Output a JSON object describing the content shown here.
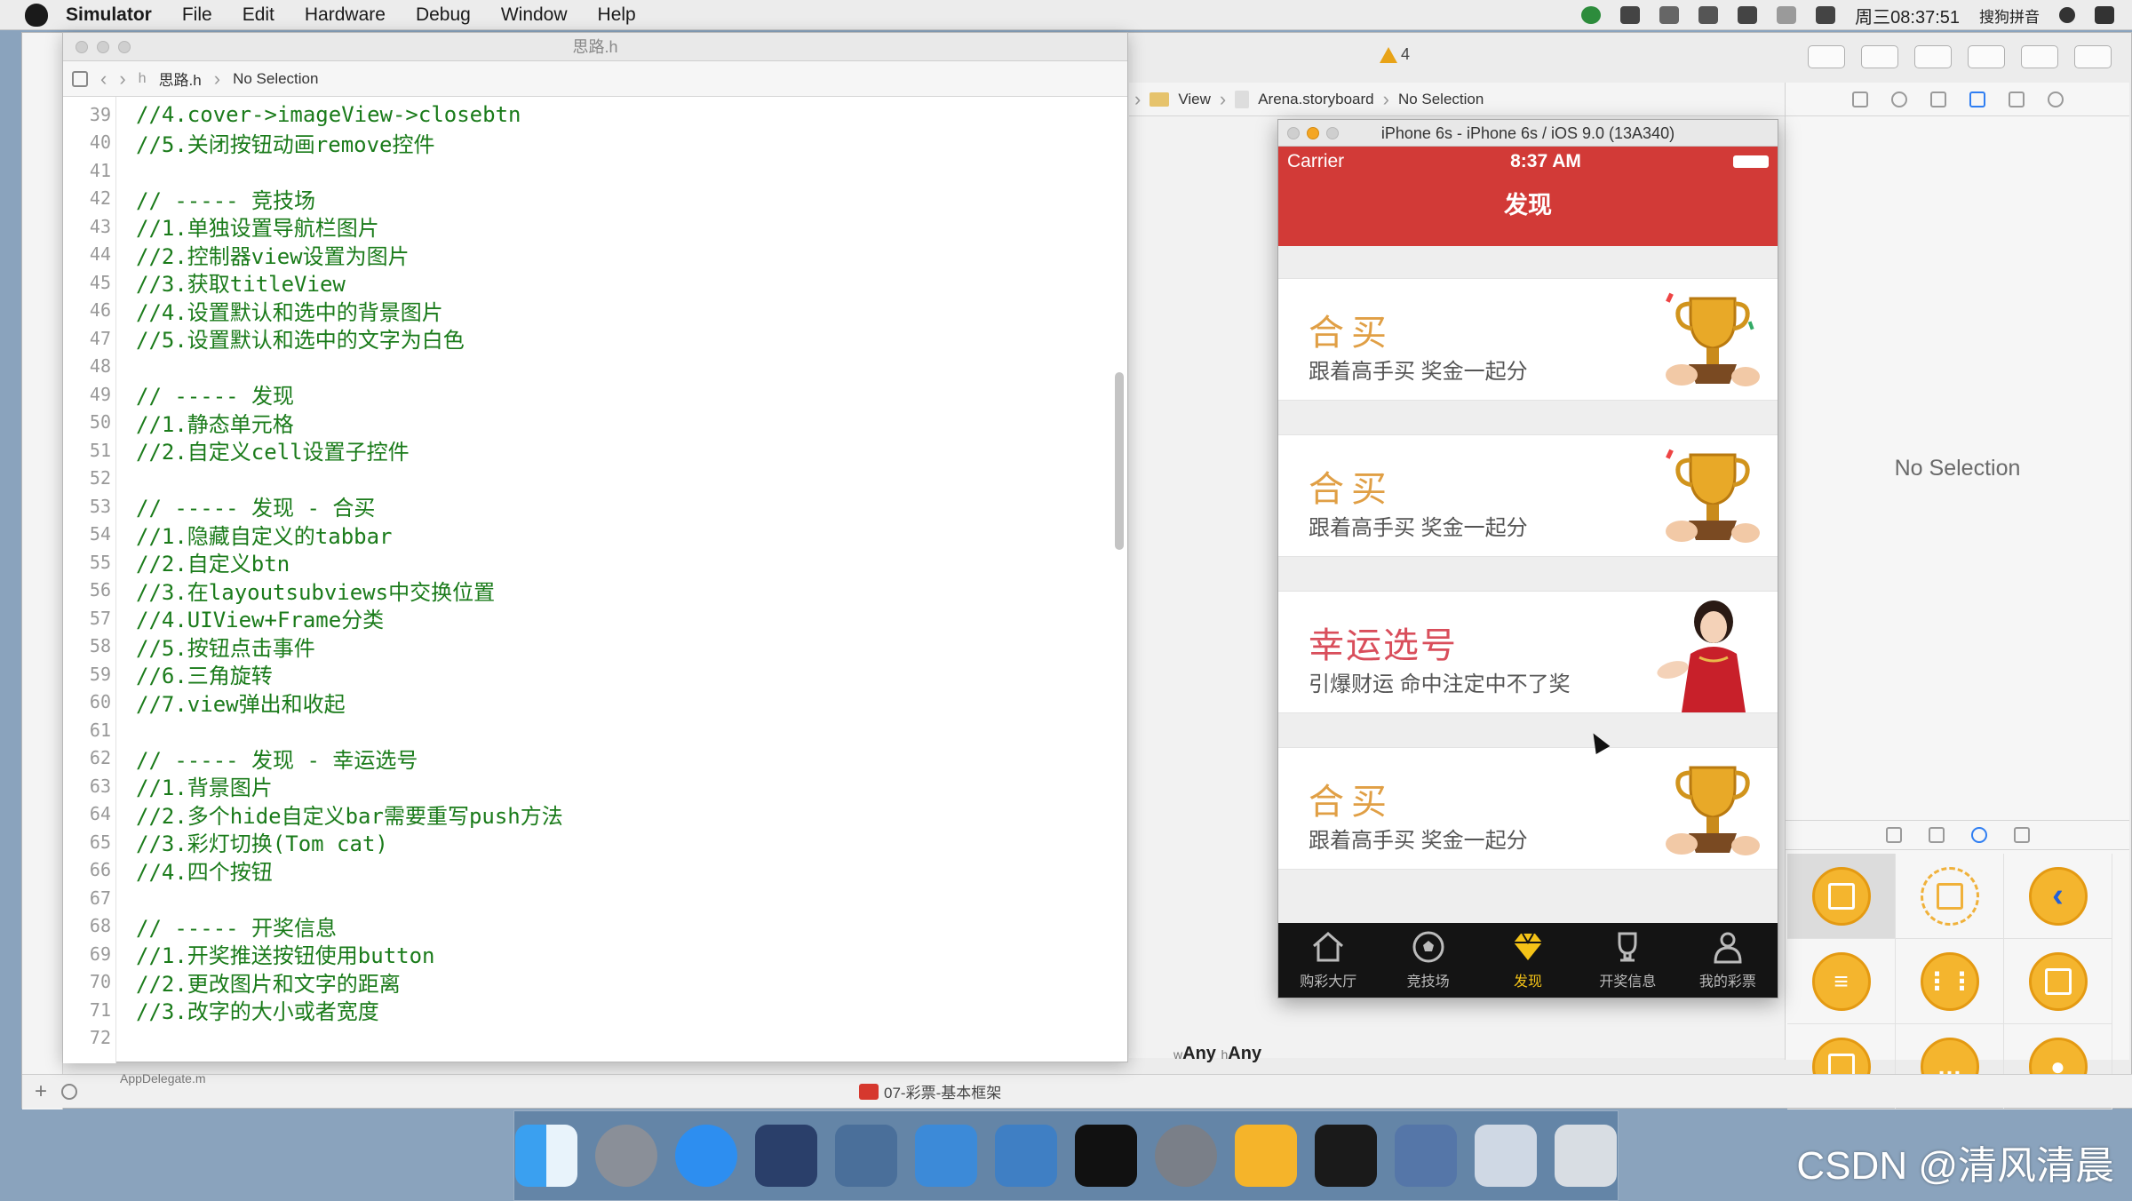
{
  "menubar": {
    "app": "Simulator",
    "items": [
      "File",
      "Edit",
      "Hardware",
      "Debug",
      "Window",
      "Help"
    ],
    "clock": "周三08:37:51",
    "input_method": "搜狗拼音"
  },
  "editor": {
    "title": "思路.h",
    "breadcrumb_file": "思路.h",
    "breadcrumb_selection": "No Selection",
    "lines": [
      {
        "num": "39",
        "text": "//4.cover->imageView->closebtn"
      },
      {
        "num": "40",
        "text": "//5.关闭按钮动画remove控件"
      },
      {
        "num": "41",
        "text": ""
      },
      {
        "num": "42",
        "text": "// ----- 竞技场"
      },
      {
        "num": "43",
        "text": "//1.单独设置导航栏图片"
      },
      {
        "num": "44",
        "text": "//2.控制器view设置为图片"
      },
      {
        "num": "45",
        "text": "//3.获取titleView"
      },
      {
        "num": "46",
        "text": "//4.设置默认和选中的背景图片"
      },
      {
        "num": "47",
        "text": "//5.设置默认和选中的文字为白色"
      },
      {
        "num": "48",
        "text": ""
      },
      {
        "num": "49",
        "text": "// ----- 发现"
      },
      {
        "num": "50",
        "text": "//1.静态单元格"
      },
      {
        "num": "51",
        "text": "//2.自定义cell设置子控件"
      },
      {
        "num": "52",
        "text": ""
      },
      {
        "num": "53",
        "text": "// ----- 发现 - 合买"
      },
      {
        "num": "54",
        "text": "//1.隐藏自定义的tabbar"
      },
      {
        "num": "55",
        "text": "//2.自定义btn"
      },
      {
        "num": "56",
        "text": "//3.在layoutsubviews中交换位置"
      },
      {
        "num": "57",
        "text": "//4.UIView+Frame分类"
      },
      {
        "num": "58",
        "text": "//5.按钮点击事件"
      },
      {
        "num": "59",
        "text": "//6.三角旋转"
      },
      {
        "num": "60",
        "text": "//7.view弹出和收起"
      },
      {
        "num": "61",
        "text": ""
      },
      {
        "num": "62",
        "text": "// ----- 发现 - 幸运选号"
      },
      {
        "num": "63",
        "text": "//1.背景图片"
      },
      {
        "num": "64",
        "text": "//2.多个hide自定义bar需要重写push方法"
      },
      {
        "num": "65",
        "text": "//3.彩灯切换(Tom cat)"
      },
      {
        "num": "66",
        "text": "//4.四个按钮"
      },
      {
        "num": "67",
        "text": ""
      },
      {
        "num": "68",
        "text": "// ----- 开奖信息"
      },
      {
        "num": "69",
        "text": "//1.开奖推送按钮使用button"
      },
      {
        "num": "70",
        "text": "//2.更改图片和文字的距离"
      },
      {
        "num": "71",
        "text": "//3.改字的大小或者宽度"
      },
      {
        "num": "72",
        "text": ""
      }
    ]
  },
  "storyboard": {
    "warning_count": "4",
    "crumb_view": "View",
    "crumb_storyboard": "Arena.storyboard",
    "crumb_selection": "No Selection",
    "size_w": "Any",
    "size_h": "Any"
  },
  "inspector": {
    "empty_text": "No Selection"
  },
  "bottom_bar": {
    "scheme": "07-彩票-基本框架",
    "file_hint": "AppDelegate.m"
  },
  "simulator": {
    "title": "iPhone 6s - iPhone 6s / iOS 9.0 (13A340)",
    "carrier": "Carrier",
    "time": "8:37 AM",
    "nav_title": "发现",
    "cards": [
      {
        "title": "合买",
        "subtitle": "跟着高手买 奖金一起分",
        "image": "trophy"
      },
      {
        "title": "合买",
        "subtitle": "跟着高手买 奖金一起分",
        "image": "trophy"
      },
      {
        "title": "幸运选号",
        "subtitle": "引爆财运 命中注定中不了奖",
        "image": "lucky-girl"
      },
      {
        "title": "合买",
        "subtitle": "跟着高手买 奖金一起分",
        "image": "trophy"
      }
    ],
    "tabs": [
      {
        "label": "购彩大厅",
        "icon": "house-icon",
        "active": false
      },
      {
        "label": "竞技场",
        "icon": "soccer-ball-icon",
        "active": false
      },
      {
        "label": "发现",
        "icon": "diamond-icon",
        "active": true
      },
      {
        "label": "开奖信息",
        "icon": "trophy-icon",
        "active": false
      },
      {
        "label": "我的彩票",
        "icon": "person-icon",
        "active": false
      }
    ]
  },
  "watermark": "CSDN @清风清晨",
  "colors": {
    "nav_red": "#d23a37",
    "code_green": "#1a7b1a",
    "tab_active": "#f4c317",
    "card_title_gold": "#e09f45",
    "card_title_red": "#d94e5b"
  }
}
